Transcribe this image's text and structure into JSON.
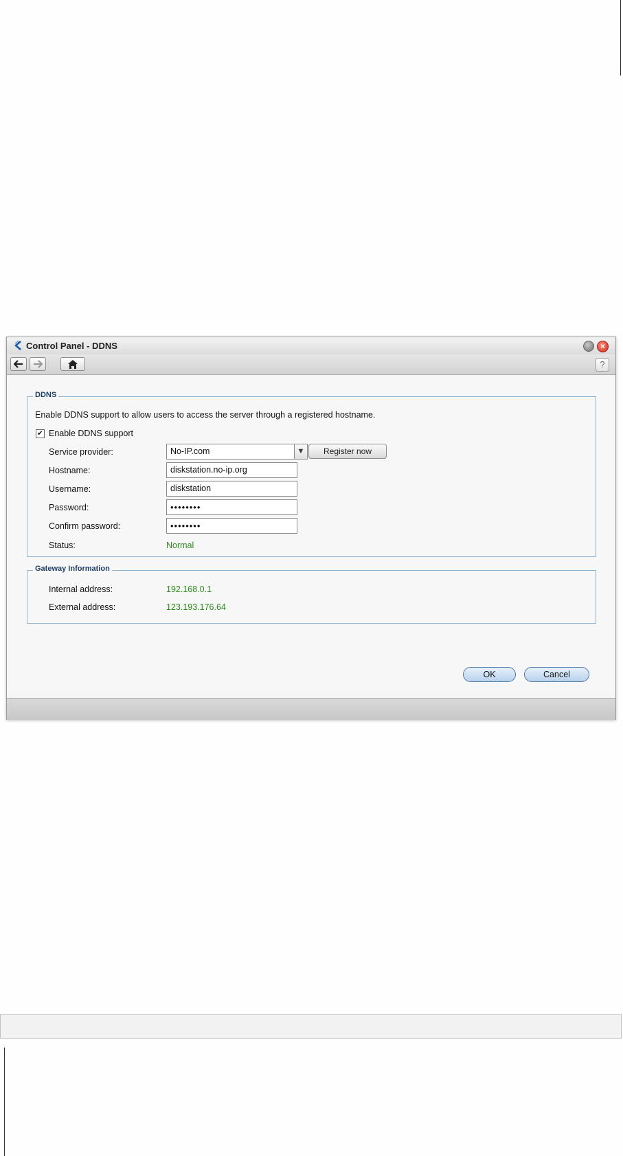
{
  "window": {
    "title": "Control Panel - DDNS"
  },
  "toolbar": {
    "back_icon": "back-arrow-icon",
    "forward_icon": "forward-arrow-icon",
    "home_icon": "home-icon",
    "help_label": "?"
  },
  "ddns": {
    "legend": "DDNS",
    "description": "Enable DDNS support to allow users to access the server through a registered hostname.",
    "enable_label": "Enable DDNS support",
    "enable_checked": true,
    "service_provider_label": "Service provider:",
    "service_provider_value": "No-IP.com",
    "register_button": "Register now",
    "hostname_label": "Hostname:",
    "hostname_value": "diskstation.no-ip.org",
    "username_label": "Username:",
    "username_value": "diskstation",
    "password_label": "Password:",
    "password_value": "••••••••",
    "confirm_password_label": "Confirm password:",
    "confirm_password_value": "••••••••",
    "status_label": "Status:",
    "status_value": "Normal"
  },
  "gateway": {
    "legend": "Gateway Information",
    "internal_label": "Internal address:",
    "internal_value": "192.168.0.1",
    "external_label": "External address:",
    "external_value": "123.193.176.64"
  },
  "buttons": {
    "ok": "OK",
    "cancel": "Cancel"
  },
  "colors": {
    "status_green": "#2c8a1c",
    "fieldset_border": "#8fb3d0",
    "legend_text": "#1d3f66"
  }
}
